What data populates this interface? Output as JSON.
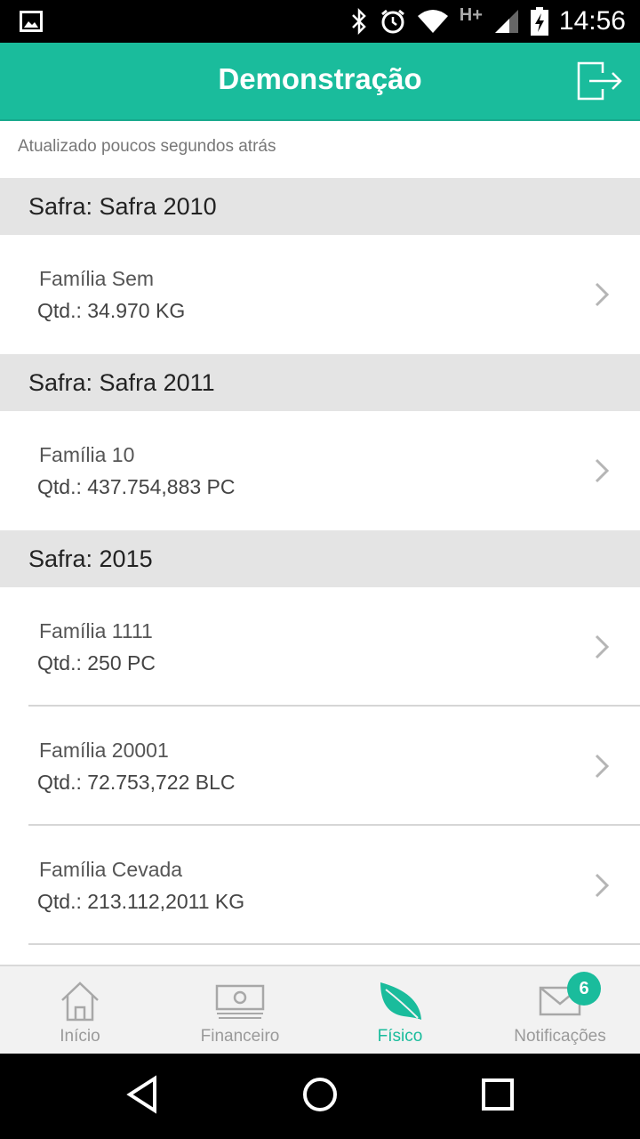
{
  "status_bar": {
    "time": "14:56",
    "icons": [
      "picture-icon",
      "bluetooth-icon",
      "alarm-icon",
      "wifi-icon",
      "network-hplus-icon",
      "signal-icon",
      "battery-charging-icon"
    ],
    "network_type": "H+"
  },
  "app_bar": {
    "title": "Demonstração",
    "logout_icon": "logout-icon"
  },
  "updated_text": "Atualizado poucos segundos atrás",
  "sections": [
    {
      "header": "Safra: Safra 2010",
      "items": [
        {
          "name": "Família Sem",
          "qty": "Qtd.: 34.970 KG"
        }
      ]
    },
    {
      "header": "Safra: Safra 2011",
      "items": [
        {
          "name": "Família 10",
          "qty": "Qtd.: 437.754,883 PC"
        }
      ]
    },
    {
      "header": "Safra: 2015",
      "items": [
        {
          "name": "Família 1111",
          "qty": "Qtd.: 250 PC"
        },
        {
          "name": "Família 20001",
          "qty": "Qtd.: 72.753,722 BLC"
        },
        {
          "name": "Família Cevada",
          "qty": "Qtd.: 213.112,2011 KG"
        }
      ]
    }
  ],
  "tabs": [
    {
      "label": "Início",
      "icon": "home-icon",
      "active": false
    },
    {
      "label": "Financeiro",
      "icon": "money-icon",
      "active": false
    },
    {
      "label": "Físico",
      "icon": "leaf-icon",
      "active": true
    },
    {
      "label": "Notificações",
      "icon": "mail-icon",
      "active": false,
      "badge": "6"
    }
  ],
  "colors": {
    "accent": "#1abc9c",
    "section_bg": "#e4e4e4",
    "tab_inactive": "#9a9a9a"
  }
}
